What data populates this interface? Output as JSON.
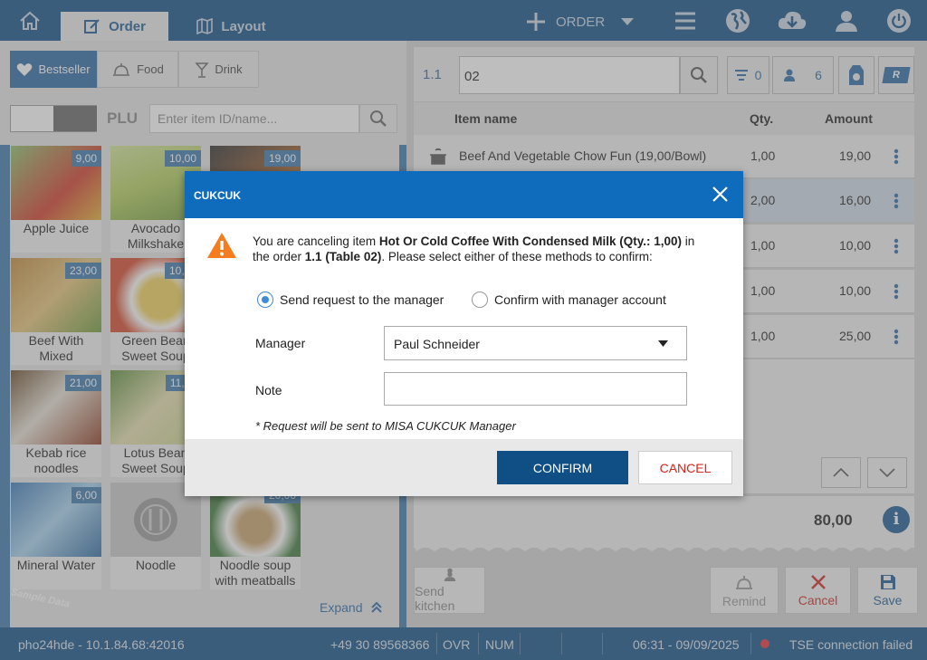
{
  "topbar": {
    "tab_order": "Order",
    "tab_layout": "Layout",
    "order_button": "ORDER"
  },
  "left": {
    "categories": [
      "Bestseller",
      "Food",
      "Drink"
    ],
    "plu_label": "PLU",
    "search_placeholder": "Enter item ID/name...",
    "items": [
      {
        "name": "Apple Juice",
        "price": "9,00"
      },
      {
        "name": "Avocado Milkshake",
        "price": "10,00"
      },
      {
        "name": "",
        "price": "19,00"
      },
      {
        "name": "Beef With Mixed",
        "price": "23,00"
      },
      {
        "name": "Green Bean Sweet Soup",
        "price": "10,00"
      },
      {
        "name": "Kebab rice noodles",
        "price": "21,00"
      },
      {
        "name": "Lotus Bean Sweet Soup",
        "price": "11,00"
      },
      {
        "name": "Mineral Water",
        "price": "6,00"
      },
      {
        "name": "Noodle",
        "price": ""
      },
      {
        "name": "Noodle soup with meatballs",
        "price": "20,00"
      }
    ],
    "expand_label": "Expand",
    "watermark": "Sample Data"
  },
  "right": {
    "order_no": "1.1",
    "table_value": "02",
    "filter_count": "0",
    "guest_count": "6",
    "r_badge": "R",
    "columns": {
      "name": "Item name",
      "qty": "Qty.",
      "amount": "Amount"
    },
    "rows": [
      {
        "name": "Beef And Vegetable Chow Fun (19,00/Bowl)",
        "qty": "1,00",
        "amount": "19,00"
      },
      {
        "name": "",
        "qty": "2,00",
        "amount": "16,00"
      },
      {
        "name": "",
        "qty": "1,00",
        "amount": "10,00"
      },
      {
        "name": "",
        "qty": "1,00",
        "amount": "10,00"
      },
      {
        "name": "",
        "qty": "1,00",
        "amount": "25,00"
      }
    ],
    "total": "80,00",
    "actions": {
      "send_kitchen": "Send kitchen",
      "remind": "Remind",
      "cancel": "Cancel",
      "save": "Save"
    }
  },
  "status": {
    "host": "pho24hde - 10.1.84.68:42016",
    "phone": "+49 30 89568366",
    "ovr": "OVR",
    "num": "NUM",
    "datetime": "06:31 - 09/09/2025",
    "tse": "TSE connection failed"
  },
  "dialog": {
    "title": "CUKCUK",
    "msg_prefix": "You are canceling item ",
    "msg_item": "Hot Or Cold Coffee With Condensed Milk (Qty.: 1,00)",
    "msg_mid": " in the order ",
    "msg_order": "1.1 (Table 02)",
    "msg_suffix": ". Please select either of these methods to confirm:",
    "option_send": "Send request to the manager",
    "option_confirm": "Confirm with manager account",
    "manager_label": "Manager",
    "manager_value": "Paul Schneider",
    "note_label": "Note",
    "note_value": "",
    "footnote": "* Request will be sent to MISA CUKCUK Manager",
    "confirm_button": "CONFIRM",
    "cancel_button": "CANCEL"
  },
  "colors": {
    "primary": "#0f4f86",
    "dialog_header": "#0f6cbc",
    "cancel_red": "#d4261f",
    "warning": "#f57c1f"
  }
}
